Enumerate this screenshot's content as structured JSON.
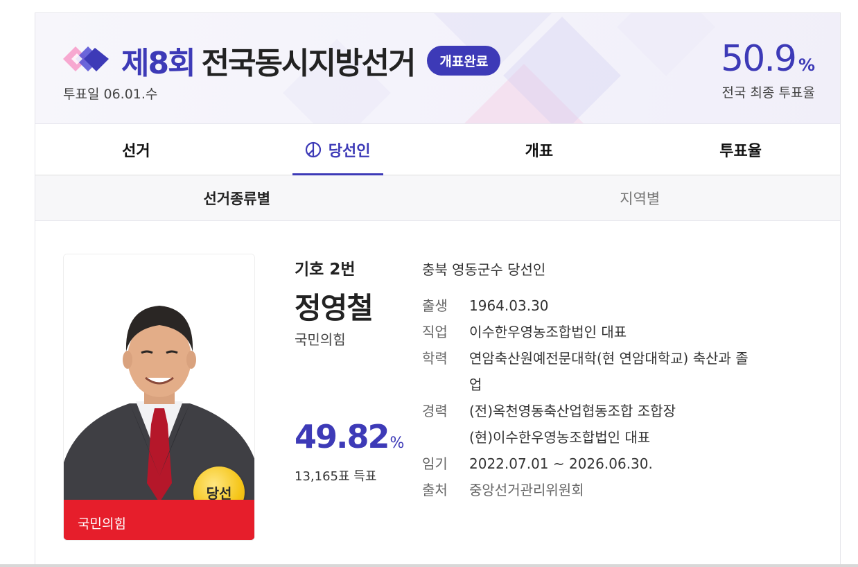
{
  "header": {
    "election_number": "제8회",
    "election_name": "전국동시지방선거",
    "status": "개표완료",
    "vote_date": "투표일 06.01.수",
    "turnout_value": "50.9",
    "turnout_unit": "%",
    "turnout_label": "전국 최종 투표율"
  },
  "tabs": [
    {
      "label": "선거",
      "active": false
    },
    {
      "label": "당선인",
      "active": true,
      "icon": "ballot-icon"
    },
    {
      "label": "개표",
      "active": false
    },
    {
      "label": "투표율",
      "active": false
    }
  ],
  "subtabs": [
    {
      "label": "선거종류별",
      "active": true
    },
    {
      "label": "지역별",
      "active": false
    }
  ],
  "candidate": {
    "party_bar": "국민의힘",
    "badge": "당선",
    "number": "기호 2번",
    "name": "정영철",
    "party": "국민의힘",
    "rate": "49.82",
    "rate_unit": "%",
    "votes": "13,165표 득표",
    "region_title": "충북 영동군수 당선인",
    "details": {
      "birth_label": "출생",
      "birth": "1964.03.30",
      "job_label": "직업",
      "job": "이수한우영농조합법인 대표",
      "edu_label": "학력",
      "edu_line1": "연암축산원예전문대학(현 연암대학교) 축산과 졸",
      "edu_line2": "업",
      "career_label": "경력",
      "career_line1": "(전)옥천영동축산업협동조합 조합장",
      "career_line2": "(현)이수한우영농조합법인 대표",
      "term_label": "임기",
      "term": "2022.07.01 ~ 2026.06.30.",
      "source_label": "출처",
      "source": "중앙선거관리위원회"
    }
  },
  "colors": {
    "accent": "#3d3ab7",
    "party_red": "#e61e2b",
    "badge_gold": "#f5c518"
  }
}
